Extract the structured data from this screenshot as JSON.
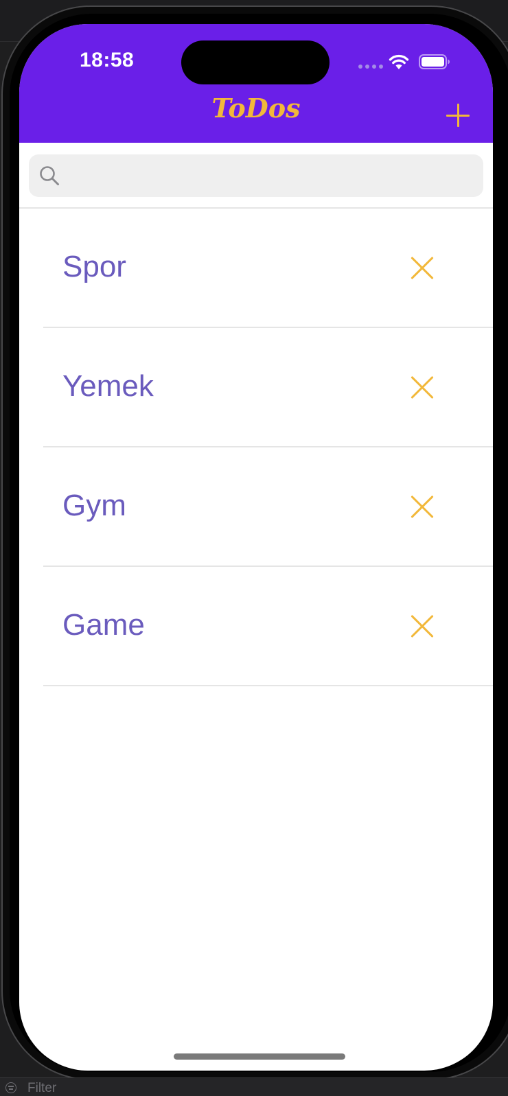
{
  "status_bar": {
    "time": "18:58"
  },
  "nav_bar": {
    "title": "ToDos",
    "add_icon": "plus-icon"
  },
  "search": {
    "placeholder": "",
    "value": "",
    "icon": "search-icon"
  },
  "todos": [
    {
      "label": "Spor",
      "delete_icon": "close-icon"
    },
    {
      "label": "Yemek",
      "delete_icon": "close-icon"
    },
    {
      "label": "Gym",
      "delete_icon": "close-icon"
    },
    {
      "label": "Game",
      "delete_icon": "close-icon"
    }
  ],
  "bottom_panel": {
    "filter_label": "Filter"
  },
  "colors": {
    "nav_background": "#6a1fe8",
    "accent": "#f2b83a",
    "item_text": "#6a5bbd",
    "search_background": "#efefef"
  }
}
